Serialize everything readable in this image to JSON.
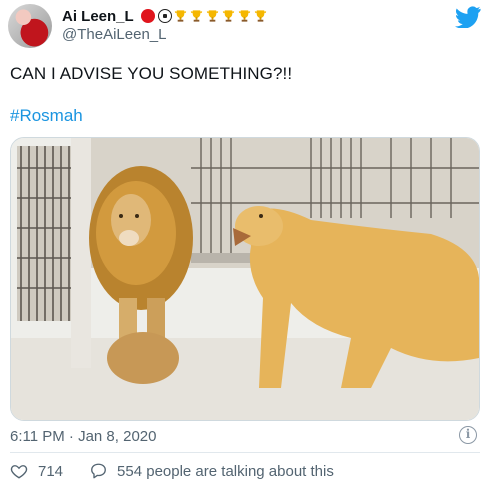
{
  "author": {
    "name": "Ai Leen_L",
    "handle": "@TheAiLeen_L",
    "name_emojis": [
      "red-circle",
      "soccer-ball",
      "trophy",
      "trophy",
      "trophy",
      "trophy",
      "trophy",
      "trophy"
    ]
  },
  "tweet": {
    "text": "CAN I ADVISE YOU SOMETHING?!!",
    "hashtag": "#Rosmah",
    "timestamp": "6:11 PM · Jan 8, 2020"
  },
  "engagement": {
    "likes": "714",
    "conversation": "554 people are talking about this"
  },
  "colors": {
    "twitter_blue": "#1da1f2",
    "hashtag_blue": "#1b95e0",
    "muted_gray": "#536471"
  }
}
